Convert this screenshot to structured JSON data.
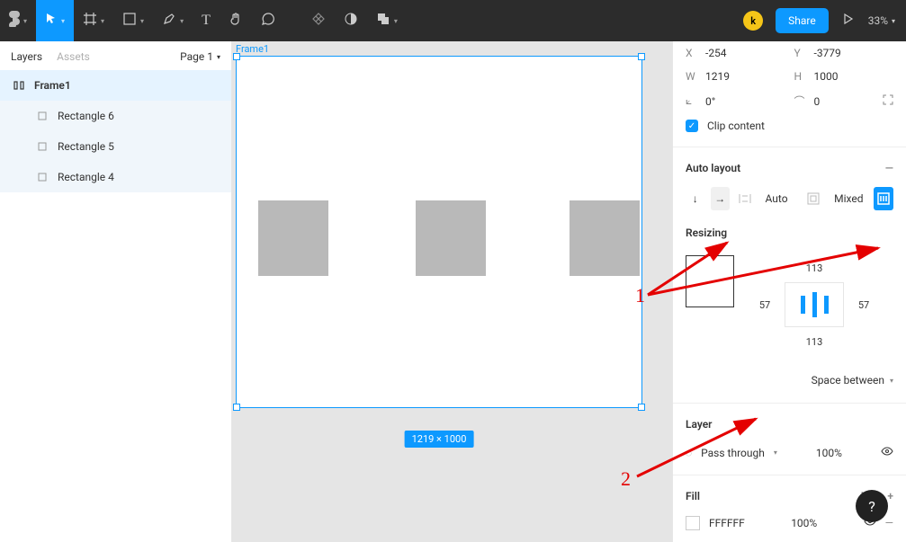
{
  "toolbar": {
    "avatar": "k",
    "share": "Share",
    "zoom": "33%"
  },
  "leftPanel": {
    "tabs": {
      "layers": "Layers",
      "assets": "Assets"
    },
    "page": "Page 1",
    "layers": [
      {
        "name": "Frame1"
      },
      {
        "name": "Rectangle 6"
      },
      {
        "name": "Rectangle 5"
      },
      {
        "name": "Rectangle 4"
      }
    ]
  },
  "canvas": {
    "frameLabel": "Frame1",
    "dimensions": "1219 × 1000"
  },
  "rightPanel": {
    "x": "-254",
    "y": "-3779",
    "w": "1219",
    "h": "1000",
    "rot": "0°",
    "rad": "0",
    "clip": "Clip content",
    "autoLayoutTitle": "Auto layout",
    "autoVal": "Auto",
    "mixedVal": "Mixed",
    "resizingTitle": "Resizing",
    "padTop": "113",
    "padBottom": "113",
    "padLeft": "57",
    "padRight": "57",
    "spaceBetween": "Space between",
    "layerTitle": "Layer",
    "passThrough": "Pass through",
    "layerOpacity": "100%",
    "fillTitle": "Fill",
    "fillHex": "FFFFFF",
    "fillOpacity": "100%"
  },
  "annotations": {
    "one": "1",
    "two": "2"
  },
  "help": "?"
}
